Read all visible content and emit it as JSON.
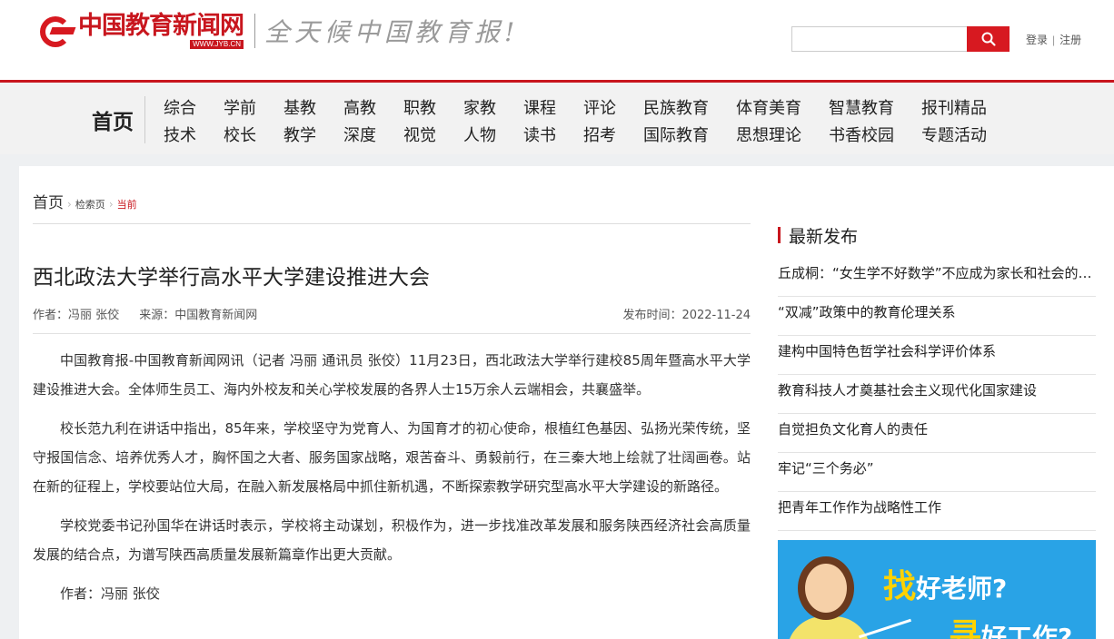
{
  "header": {
    "logo_cn": "中国教育新闻网",
    "logo_url": "WWW.JYB.CN",
    "slogan": "全天候中国教育报!",
    "search_placeholder": "",
    "login": "登录",
    "auth_sep": "|",
    "register": "注册"
  },
  "nav": {
    "home": "首页",
    "row1": [
      "综合",
      "学前",
      "基教",
      "高教",
      "职教",
      "家教",
      "课程",
      "评论",
      "民族教育",
      "体育美育",
      "智慧教育",
      "报刊精品"
    ],
    "row2": [
      "技术",
      "校长",
      "教学",
      "深度",
      "视觉",
      "人物",
      "读书",
      "招考",
      "国际教育",
      "思想理论",
      "书香校园",
      "专题活动"
    ]
  },
  "breadcrumb": {
    "home": "首页",
    "search": "检索页",
    "current": "当前"
  },
  "article": {
    "title": "西北政法大学举行高水平大学建设推进大会",
    "author_label": "作者：冯丽 张佼",
    "source_label": "来源：中国教育新闻网",
    "date_label": "发布时间：2022-11-24",
    "paragraphs": [
      "中国教育报-中国教育新闻网讯（记者 冯丽 通讯员 张佼）11月23日，西北政法大学举行建校85周年暨高水平大学建设推进大会。全体师生员工、海内外校友和关心学校发展的各界人士15万余人云端相会，共襄盛举。",
      "校长范九利在讲话中指出，85年来，学校坚守为党育人、为国育才的初心使命，根植红色基因、弘扬光荣传统，坚守报国信念、培养优秀人才，胸怀国之大者、服务国家战略，艰苦奋斗、勇毅前行，在三秦大地上绘就了壮阔画卷。站在新的征程上，学校要站位大局，在融入新发展格局中抓住新机遇，不断探索教学研究型高水平大学建设的新路径。",
      "学校党委书记孙国华在讲话时表示，学校将主动谋划，积极作为，进一步找准改革发展和服务陕西经济社会高质量发展的结合点，为谱写陕西高质量发展新篇章作出更大贡献。",
      "作者：冯丽 张佼"
    ]
  },
  "sidebar": {
    "latest_title": "最新发布",
    "latest": [
      "丘成桐：“女生学不好数学”不应成为家长和社会的偏见",
      "“双减”政策中的教育伦理关系",
      "建构中国特色哲学社会科学评价体系",
      "教育科技人才奠基社会主义现代化国家建设",
      "自觉担负文化育人的责任",
      "牢记“三个务必”",
      "把青年工作作为战略性工作"
    ],
    "ad": {
      "line1_hl": "找",
      "line1": "好老师?",
      "line2_hl": "寻",
      "line2": "好工作?"
    }
  },
  "colors": {
    "brand_red": "#c8161e",
    "ad_blue": "#29a3e6",
    "ad_yellow": "#ffd200"
  }
}
